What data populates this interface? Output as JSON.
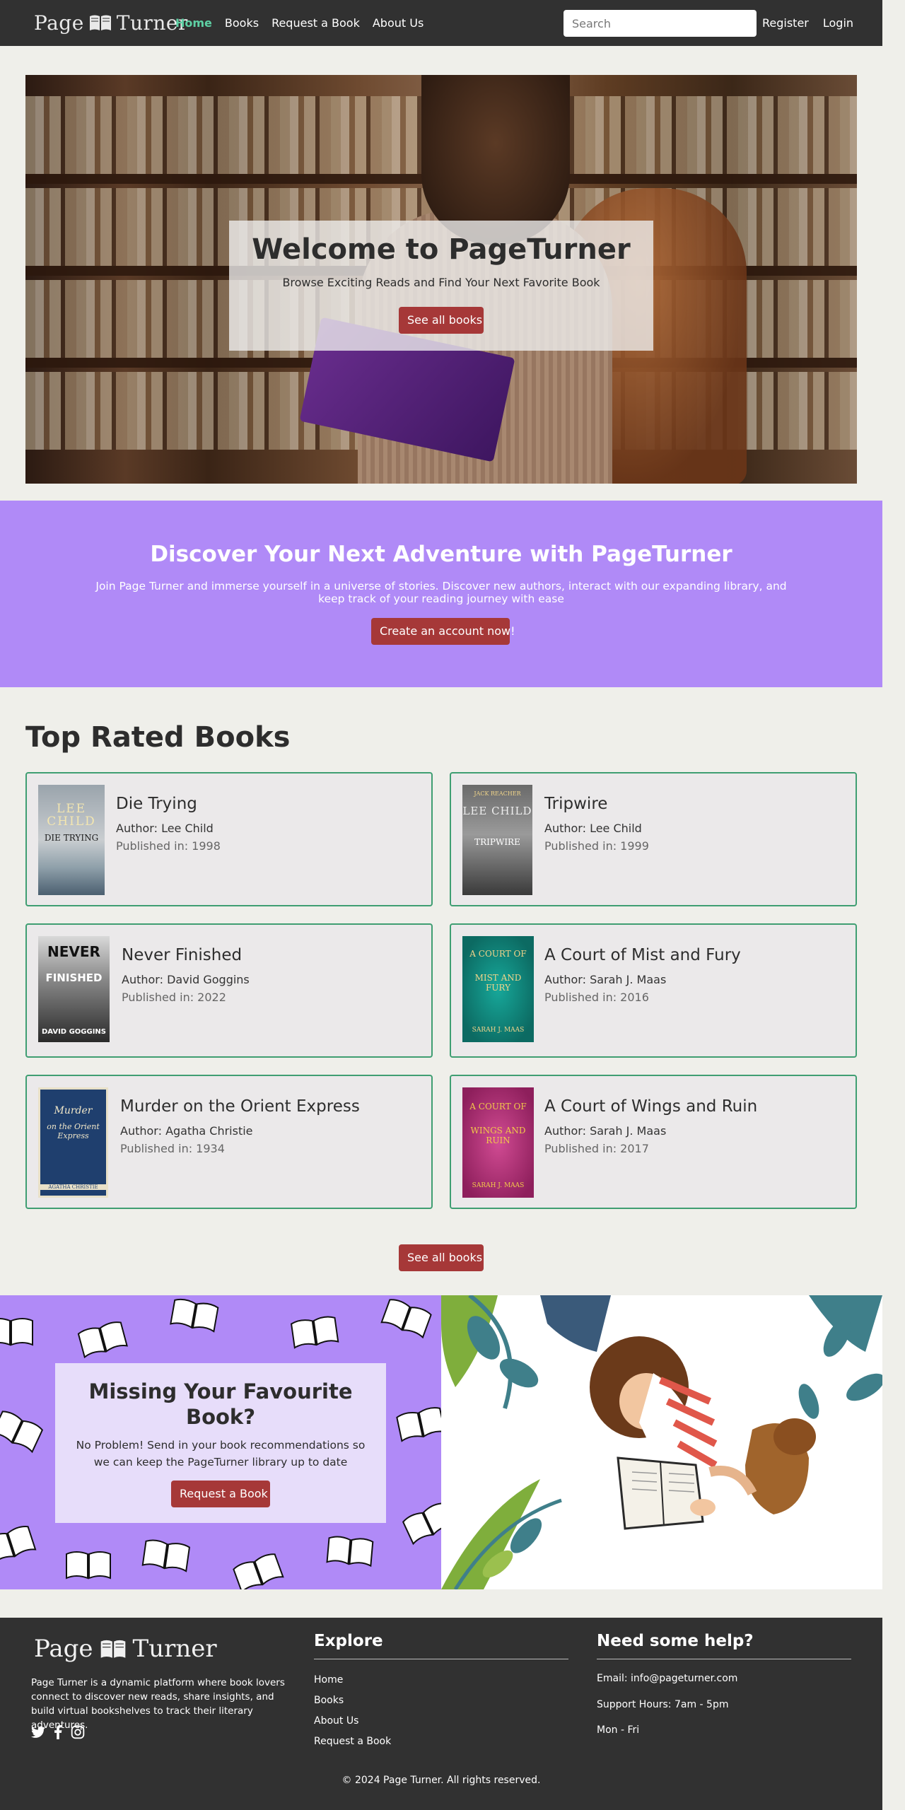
{
  "nav": {
    "brand_left": "Page",
    "brand_right": "Turner",
    "links": [
      "Home",
      "Books",
      "Request a Book",
      "About Us"
    ],
    "search_placeholder": "Search",
    "register": "Register",
    "login": "Login",
    "active_color": "#5ed0a4"
  },
  "hero": {
    "title": "Welcome to PageTurner",
    "subtitle": "Browse Exciting Reads and Find Your Next Favorite Book",
    "button": "See all books"
  },
  "banner": {
    "title": "Discover Your Next Adventure with PageTurner",
    "text": "Join Page Turner and immerse yourself in a universe of stories. Discover new authors, interact with our expanding library, and keep track of your reading journey with ease",
    "button": "Create an account now!",
    "color": "#b08af7"
  },
  "top_rated": {
    "title": "Top Rated Books",
    "books": [
      {
        "title": "Die Trying",
        "author": "Author: Lee Child",
        "published": "Published in: 1998",
        "cover_top": "LEE",
        "cover_mid": "CHILD",
        "cover_bottom": "DIE TRYING"
      },
      {
        "title": "Tripwire",
        "author": "Author: Lee Child",
        "published": "Published in: 1999",
        "cover_top": "JACK REACHER",
        "cover_mid": "LEE CHILD",
        "cover_bottom": "TRIPWIRE"
      },
      {
        "title": "Never Finished",
        "author": "Author: David Goggins",
        "published": "Published in: 2022",
        "cover_top": "NEVER",
        "cover_mid": "FINISHED",
        "cover_bottom": "DAVID GOGGINS"
      },
      {
        "title": "A Court of Mist and Fury",
        "author": "Author: Sarah J. Maas",
        "published": "Published in: 2016",
        "cover_top": "A COURT OF",
        "cover_mid": "MIST AND FURY",
        "cover_bottom": "SARAH J. MAAS"
      },
      {
        "title": "Murder on the Orient Express",
        "author": "Author: Agatha Christie",
        "published": "Published in: 1934",
        "cover_top": "Murder",
        "cover_mid": "on the Orient Express",
        "cover_bottom": "AGATHA CHRISTIE"
      },
      {
        "title": "A Court of Wings and Ruin",
        "author": "Author: Sarah J. Maas",
        "published": "Published in: 2017",
        "cover_top": "A COURT OF",
        "cover_mid": "WINGS AND RUIN",
        "cover_bottom": "SARAH J. MAAS"
      }
    ],
    "button": "See all books",
    "card_border": "#3f9e72"
  },
  "missing": {
    "title": "Missing Your Favourite Book?",
    "text": "No Problem! Send in your book recommendations so we can keep the PageTurner library up to date",
    "button": "Request a Book"
  },
  "footer": {
    "brand_left": "Page",
    "brand_right": "Turner",
    "about": "Page Turner is a dynamic platform where book lovers connect to discover new reads, share insights, and build virtual bookshelves to track their literary adventures.",
    "explore_title": "Explore",
    "explore_links": [
      "Home",
      "Books",
      "About Us",
      "Request a Book"
    ],
    "help_title": "Need some help?",
    "help_items": [
      "Email: info@pageturner.com",
      "Support Hours: 7am - 5pm",
      "Mon - Fri"
    ],
    "copyright": "© 2024 Page Turner. All rights reserved.",
    "socials": [
      "twitter-icon",
      "facebook-icon",
      "instagram-icon"
    ]
  },
  "button_color": "#a63838"
}
